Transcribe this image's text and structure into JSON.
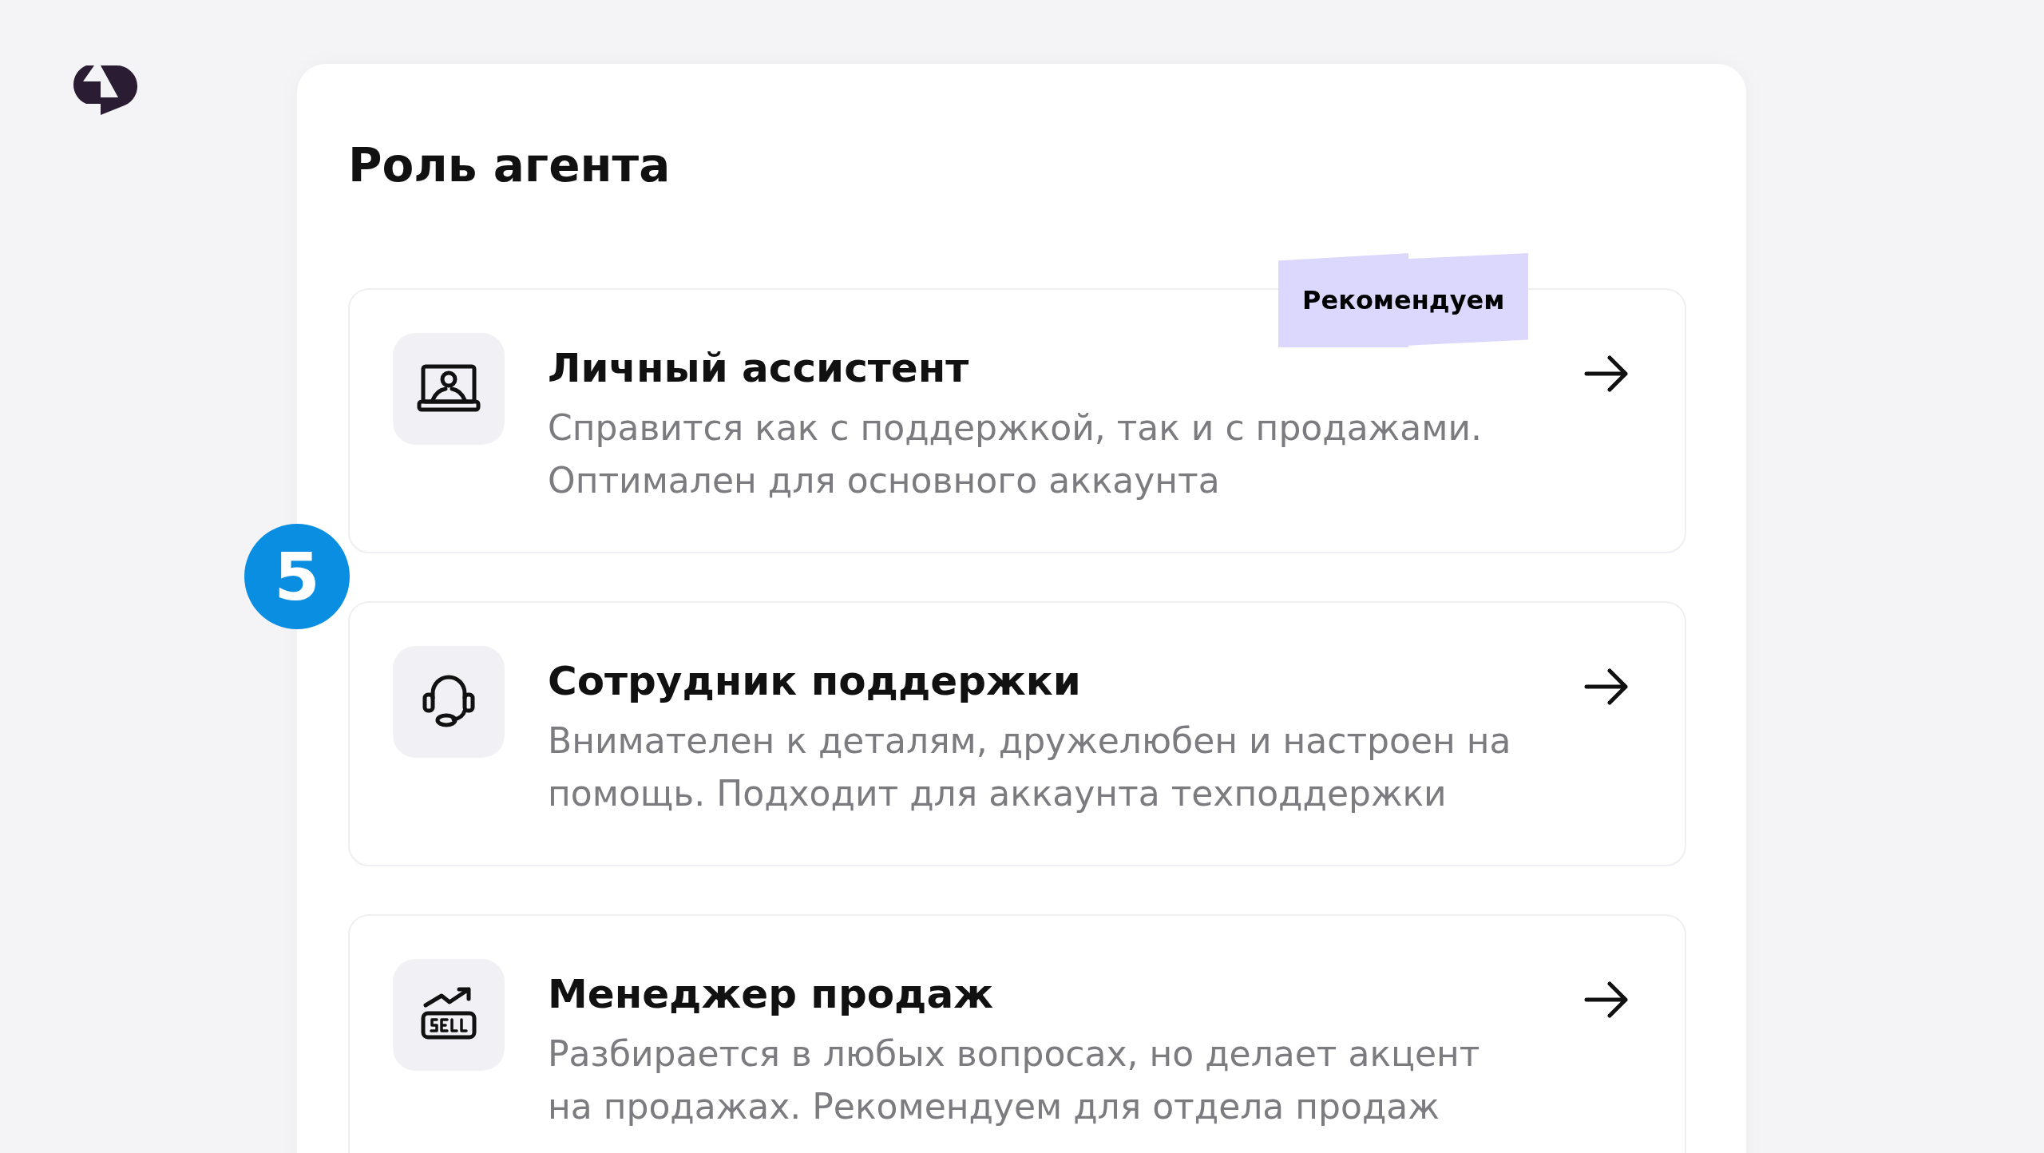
{
  "step_marker": "5",
  "title": "Роль агента",
  "roles": [
    {
      "kind": "laptop-user",
      "title": "Личный ассистент",
      "description": "Справится как с поддержкой, так и с продажами. Оптимален для основного аккаунта",
      "badge": "Рекомендуем"
    },
    {
      "kind": "headset",
      "title": "Сотрудник поддержки",
      "description": "Внимателен к деталям, дружелюбен и настроен на помощь. Подходит для аккаунта техподдержки"
    },
    {
      "kind": "sell",
      "title": "Менеджер продаж",
      "description": "Разбирается в любых вопросах, но делает акцент на продажах. Рекомендуем для отдела продаж"
    }
  ]
}
